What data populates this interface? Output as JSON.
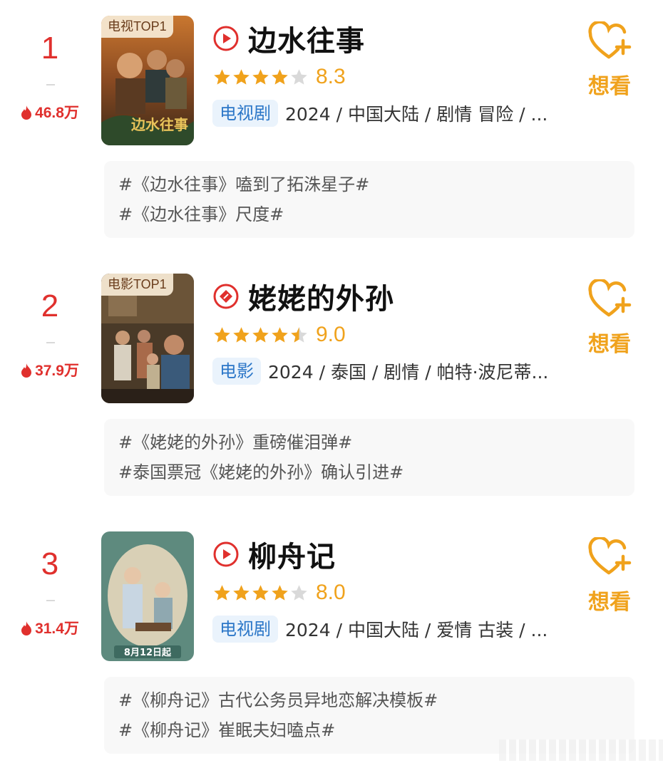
{
  "colors": {
    "rank_red": "#e0302d",
    "star_gold": "#f0a21c",
    "star_empty": "#d9d9d9",
    "badge_blue": "#2c77c8"
  },
  "items": [
    {
      "rank": "1",
      "heat": "46.8万",
      "poster_tag": "电视TOP1",
      "type_icon": "play-circle-icon",
      "title": "边水往事",
      "stars_filled": 4,
      "stars_half": 0,
      "score": "8.3",
      "type": "电视剧",
      "meta": "2024 / 中国大陆 / 剧情 冒险 / ...",
      "want_label": "想看",
      "topics": [
        "#《边水往事》嗑到了拓洙星子#",
        "#《边水往事》尺度#"
      ]
    },
    {
      "rank": "2",
      "heat": "37.9万",
      "poster_tag": "电影TOP1",
      "type_icon": "movie-ticket-icon",
      "title": "姥姥的外孙",
      "stars_filled": 4,
      "stars_half": 1,
      "score": "9.0",
      "type": "电影",
      "meta": "2024 / 泰国 / 剧情 / 帕特·波尼蒂...",
      "want_label": "想看",
      "topics": [
        "#《姥姥的外孙》重磅催泪弹#",
        "#泰国票冠《姥姥的外孙》确认引进#"
      ]
    },
    {
      "rank": "3",
      "heat": "31.4万",
      "poster_tag": "",
      "poster_caption": "8月12日起",
      "type_icon": "play-circle-icon",
      "title": "柳舟记",
      "stars_filled": 4,
      "stars_half": 0,
      "score": "8.0",
      "type": "电视剧",
      "meta": "2024 / 中国大陆 / 爱情 古装 / ...",
      "want_label": "想看",
      "topics": [
        "#《柳舟记》古代公务员异地恋解决模板#",
        "#《柳舟记》崔眠夫妇嗑点#"
      ]
    }
  ]
}
